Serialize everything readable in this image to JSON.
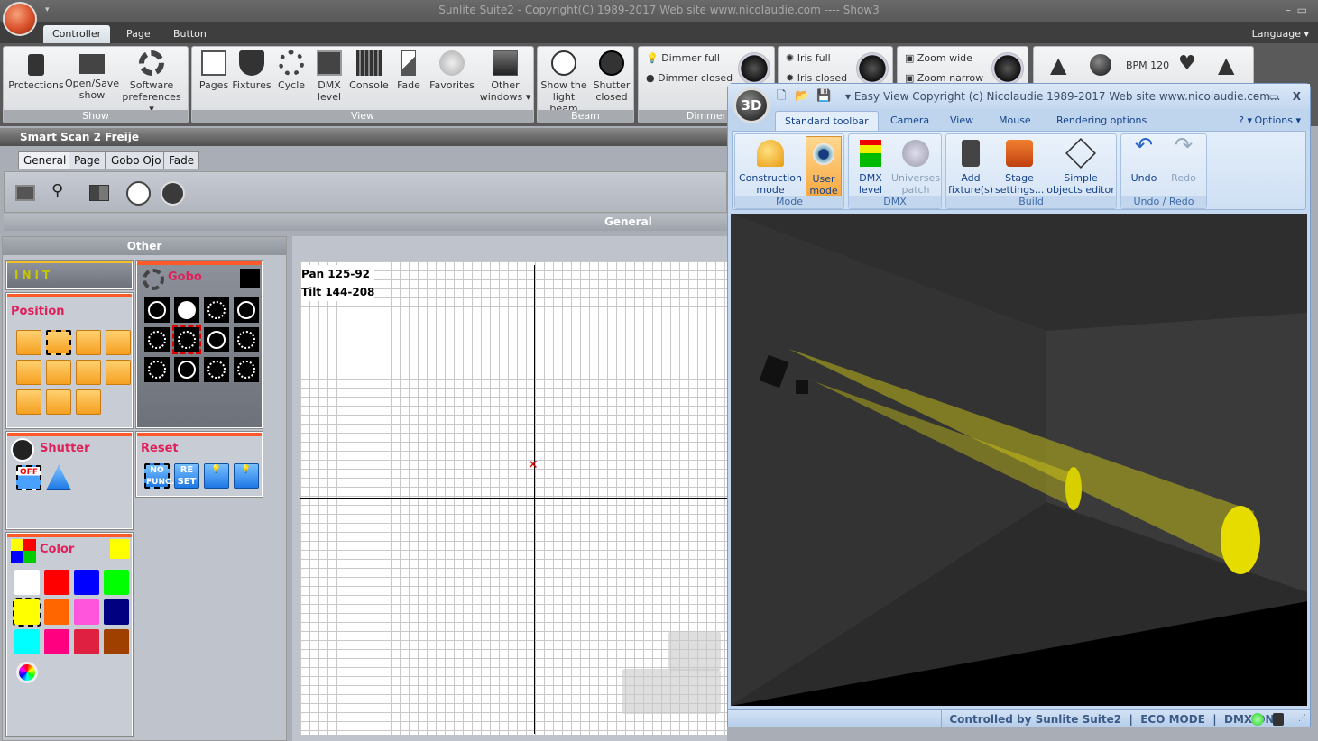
{
  "app": {
    "title": "Sunlite Suite2 - Copyright(C) 1989-2017    Web site www.nicolaudie.com ---- Show3",
    "language": "Language"
  },
  "tabs": [
    "Controller",
    "Page",
    "Button"
  ],
  "ribbon": {
    "show": {
      "label": "Show",
      "buttons": [
        "Protections",
        "Open/Save show",
        "Software preferences"
      ]
    },
    "view": {
      "label": "View",
      "buttons": [
        "Pages",
        "Fixtures",
        "Cycle",
        "DMX level",
        "Console",
        "Fade",
        "Favorites",
        "Other windows"
      ]
    },
    "beam": {
      "label": "Beam",
      "buttons": [
        "Show the light beam",
        "Shutter closed"
      ]
    },
    "dimmer": {
      "label": "Dimmer",
      "items": [
        "Dimmer full",
        "Dimmer closed"
      ]
    },
    "iris": {
      "items": [
        "Iris full",
        "Iris closed"
      ]
    },
    "zoom": {
      "items": [
        "Zoom wide",
        "Zoom narrow"
      ]
    },
    "bpm": {
      "label": "BPM 120"
    }
  },
  "fixture": {
    "name": "Smart Scan 2 Freije",
    "tabs": [
      "General",
      "Page",
      "Gobo Ojo",
      "Fade"
    ],
    "section": "General"
  },
  "other": {
    "title": "Other",
    "init": "INIT",
    "position": "Position",
    "gobo": "Gobo",
    "shutter": "Shutter",
    "shutter_off": "OFF",
    "reset": "Reset",
    "reset_buttons": [
      "NO FUNC.",
      "RE SET"
    ],
    "color": "Color",
    "colors": [
      "#ffffff",
      "#ff0000",
      "#0000ff",
      "#00ff00",
      "#ffff00",
      "#ff6600",
      "#ff55dd",
      "#000080",
      "#00ffff",
      "#ff0080",
      "#e02040",
      "#a04000"
    ],
    "selected_color": "#ffff00"
  },
  "pantilt": {
    "pan": "Pan 125-92",
    "tilt": "Tilt 144-208"
  },
  "easyview": {
    "title": "Easy View   Copyright (c) Nicolaudie 1989-2017    Web site www.nicolaudie.com...",
    "logo": "3D",
    "tabs": [
      "Standard toolbar",
      "Camera",
      "View",
      "Mouse",
      "Rendering options"
    ],
    "help": "?",
    "options": "Options",
    "groups": [
      {
        "label": "Mode",
        "buttons": [
          "Construction mode",
          "User mode"
        ]
      },
      {
        "label": "DMX",
        "buttons": [
          "DMX level",
          "Universes patch"
        ]
      },
      {
        "label": "Build",
        "buttons": [
          "Add fixture(s)",
          "Stage settings...",
          "Simple objects editor"
        ]
      },
      {
        "label": "Undo / Redo",
        "buttons": [
          "Undo",
          "Redo"
        ]
      }
    ],
    "status": {
      "controlled": "Controlled by Sunlite Suite2",
      "eco": "ECO MODE",
      "dmx": "DMX ON",
      "sep": "|"
    }
  }
}
